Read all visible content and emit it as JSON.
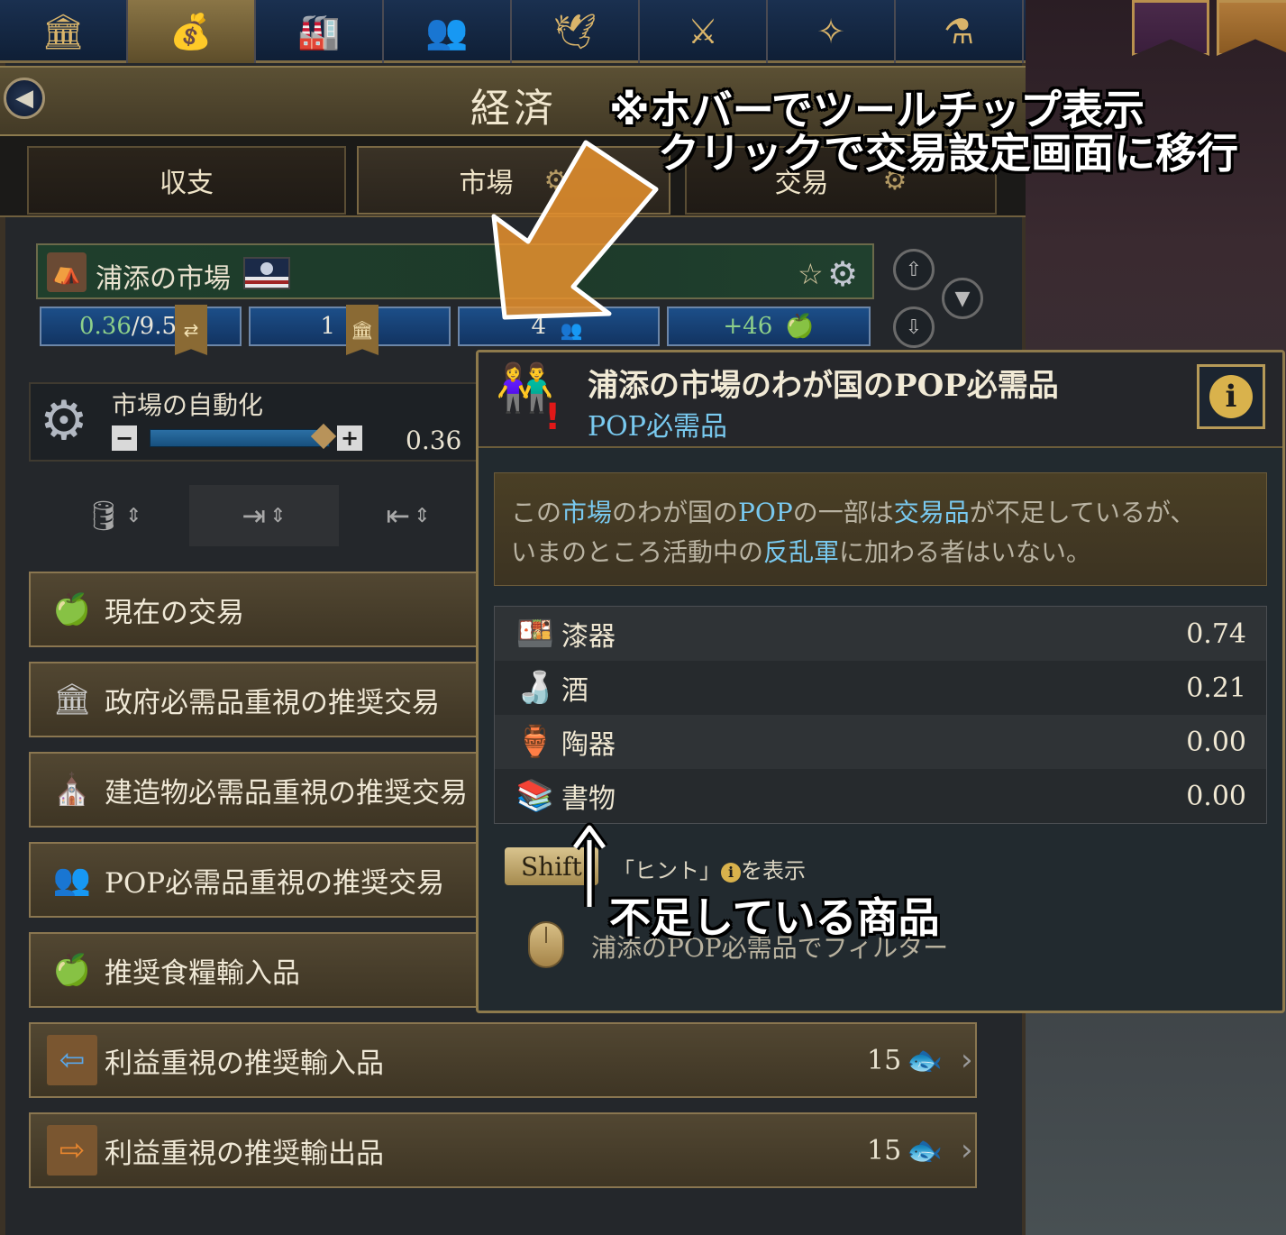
{
  "nav": {
    "tabs": [
      {
        "icon": "government-icon",
        "glyph": "🏛"
      },
      {
        "icon": "economy-icon",
        "glyph": "💰"
      },
      {
        "icon": "buildings-icon",
        "glyph": "🏭"
      },
      {
        "icon": "population-icon",
        "glyph": "👥"
      },
      {
        "icon": "diplomacy-icon",
        "glyph": "🕊"
      },
      {
        "icon": "military-icon",
        "glyph": "⚔"
      },
      {
        "icon": "compass-icon",
        "glyph": "✧"
      },
      {
        "icon": "research-flask-icon",
        "glyph": "⚗"
      }
    ],
    "active_index": 1
  },
  "header": {
    "title": "経済",
    "back_glyph": "◀"
  },
  "subtabs": {
    "balance": "収支",
    "market": "市場",
    "trade": "交易"
  },
  "market": {
    "name": "浦添の市場",
    "star_glyph": "☆",
    "settings_glyph": "⚙",
    "stats": {
      "access_current": "0.36",
      "access_max": "/9.51",
      "government_needs": "1",
      "pop_needs": "4",
      "food": "+46"
    },
    "sort_up_glyph": "⇧",
    "sort_down_glyph": "⇩",
    "filter_glyph": "▼"
  },
  "automation": {
    "label": "市場の自動化",
    "value": "0.36",
    "level": 0.36,
    "minus": "−",
    "plus": "+"
  },
  "trade_buttons": [
    {
      "label": "現在の交易",
      "icon": "trade-goods-icon",
      "glyph": "🍏"
    },
    {
      "label": "政府必需品重視の推奨交易",
      "icon": "government-needs-icon",
      "glyph": "🏛"
    },
    {
      "label": "建造物必需品重視の推奨交易",
      "icon": "building-needs-icon",
      "glyph": "⛪"
    },
    {
      "label": "POP必需品重視の推奨交易",
      "icon": "pop-needs-icon",
      "glyph": "👥"
    },
    {
      "label": "推奨食糧輸入品",
      "icon": "food-import-icon",
      "glyph": "🍏"
    },
    {
      "label": "利益重視の推奨輸入品",
      "icon": "import-crate-icon",
      "glyph": "⇦",
      "count": "15"
    },
    {
      "label": "利益重視の推奨輸出品",
      "icon": "export-crate-icon",
      "glyph": "⇨",
      "count": "15"
    }
  ],
  "tooltip": {
    "title": "浦添の市場のわが国のPOP必需品",
    "subtitle": "POP必需品",
    "info_glyph": "i",
    "description": {
      "p1": "この",
      "h1": "市場",
      "p2": "のわが国の",
      "h2": "POP",
      "p3": "の一部は",
      "h3": "交易品",
      "p4": "が不足しているが、",
      "p5": "いまのところ活動中の",
      "h4": "反乱軍",
      "p6": "に加わる者はいない。"
    },
    "goods": [
      {
        "name": "漆器",
        "value": "0.74",
        "icon": "lacquerware-icon",
        "glyph": "🍱"
      },
      {
        "name": "酒",
        "value": "0.21",
        "icon": "liquor-jug-icon",
        "glyph": "🍶"
      },
      {
        "name": "陶器",
        "value": "0.00",
        "icon": "pottery-icon",
        "glyph": "🏺"
      },
      {
        "name": "書物",
        "value": "0.00",
        "icon": "books-icon",
        "glyph": "📚"
      }
    ],
    "shift_key": "Shift",
    "hint_prefix": "「ヒント」",
    "hint_suffix": "を表示",
    "filter_text": "浦添のPOP必需品でフィルター"
  },
  "annotations": {
    "line1": "※ホバーでツールチップ表示",
    "line2": "クリックで交易設定画面に移行",
    "missing_goods": "不足している商品"
  },
  "colors": {
    "highlight": "#79c9ef",
    "arrow_orange": "#e8922e",
    "warning_red": "#e01818"
  }
}
